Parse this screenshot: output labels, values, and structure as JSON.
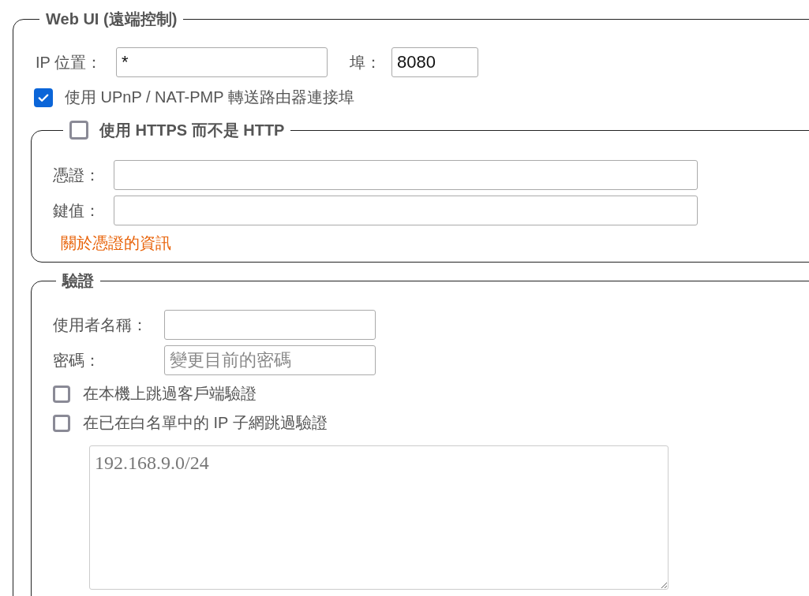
{
  "web_ui": {
    "legend": "Web UI (遠端控制)",
    "ip_label": "IP 位置：",
    "ip_value": "*",
    "port_label": "埠：",
    "port_value": "8080",
    "upnp": {
      "label": "使用 UPnP / NAT-PMP 轉送路由器連接埠",
      "checked": true
    },
    "https": {
      "label": "使用 HTTPS 而不是 HTTP",
      "checked": false,
      "cert_label": "憑證：",
      "key_label": "鍵值：",
      "info_link": "關於憑證的資訊"
    },
    "auth": {
      "legend": "驗證",
      "username_label": "使用者名稱：",
      "password_label": "密碼：",
      "password_placeholder": "變更目前的密碼",
      "options": [
        {
          "label": "在本機上跳過客戶端驗證",
          "checked": false
        },
        {
          "label": "在已在白名單中的 IP 子網跳過驗證",
          "checked": false
        }
      ],
      "whitelist_placeholder": "192.168.9.0/24"
    }
  }
}
